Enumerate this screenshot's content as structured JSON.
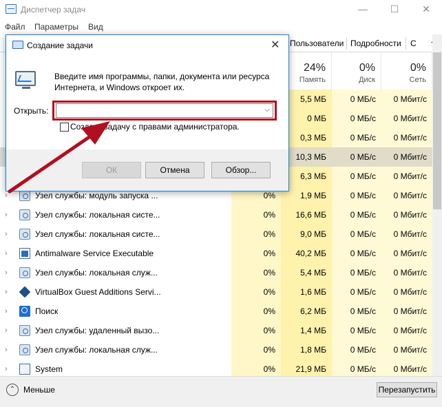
{
  "window": {
    "title": "Диспетчер задач",
    "min": "—",
    "max": "☐",
    "close": "✕"
  },
  "menu": [
    "Файл",
    "Параметры",
    "Вид"
  ],
  "tabs": [
    "Пользователи",
    "Подробности",
    "С"
  ],
  "tab_arrow": "◀▶",
  "columns": {
    "cpu": {
      "pct": "",
      "label": ""
    },
    "memory": {
      "pct": "24%",
      "label": "Память"
    },
    "disk": {
      "pct": "0%",
      "label": "Диск"
    },
    "network": {
      "pct": "0%",
      "label": "Сеть"
    }
  },
  "rows": [
    {
      "name": "",
      "icon": "",
      "cpu": "",
      "mem": "5,5 МБ",
      "disk": "0 МБ/с",
      "net": "0 Мбит/с"
    },
    {
      "name": "",
      "icon": "",
      "cpu": "",
      "mem": "0 МБ",
      "disk": "0 МБ/с",
      "net": "0 Мбит/с"
    },
    {
      "name": "",
      "icon": "",
      "cpu": "",
      "mem": "0,3 МБ",
      "disk": "0 МБ/с",
      "net": "0 Мбит/с"
    },
    {
      "name": "",
      "icon": "",
      "cpu": "",
      "mem": "10,3 МБ",
      "disk": "0 МБ/с",
      "net": "0 Мбит/с",
      "selected": true
    },
    {
      "name": "",
      "icon": "",
      "cpu": "",
      "mem": "6,3 МБ",
      "disk": "0 МБ/с",
      "net": "0 Мбит/с"
    },
    {
      "name": "Узел службы: модуль запуска ...",
      "icon": "gear-icon",
      "cpu": "0%",
      "mem": "1,9 МБ",
      "disk": "0 МБ/с",
      "net": "0 Мбит/с"
    },
    {
      "name": "Узел службы: локальная систе...",
      "icon": "gear-icon",
      "cpu": "0%",
      "mem": "16,6 МБ",
      "disk": "0 МБ/с",
      "net": "0 Мбит/с"
    },
    {
      "name": "Узел службы: локальная систе...",
      "icon": "gear-icon",
      "cpu": "0%",
      "mem": "9,0 МБ",
      "disk": "0 МБ/с",
      "net": "0 Мбит/с"
    },
    {
      "name": "Antimalware Service Executable",
      "icon": "window-icon",
      "cpu": "0%",
      "mem": "40,2 МБ",
      "disk": "0 МБ/с",
      "net": "0 Мбит/с"
    },
    {
      "name": "Узел службы: локальная служ...",
      "icon": "gear-icon",
      "cpu": "0%",
      "mem": "5,4 МБ",
      "disk": "0 МБ/с",
      "net": "0 Мбит/с"
    },
    {
      "name": "VirtualBox Guest Additions Servi...",
      "icon": "virtualbox-icon",
      "cpu": "0%",
      "mem": "1,6 МБ",
      "disk": "0 МБ/с",
      "net": "0 Мбит/с"
    },
    {
      "name": "Поиск",
      "icon": "search-app-icon",
      "cpu": "0%",
      "mem": "6,2 МБ",
      "disk": "0 МБ/с",
      "net": "0 Мбит/с"
    },
    {
      "name": "Узел службы: удаленный вызо...",
      "icon": "gear-icon",
      "cpu": "0%",
      "mem": "1,4 МБ",
      "disk": "0 МБ/с",
      "net": "0 Мбит/с"
    },
    {
      "name": "Узел службы: локальная служ...",
      "icon": "gear-icon",
      "cpu": "0%",
      "mem": "1,8 МБ",
      "disk": "0 МБ/с",
      "net": "0 Мбит/с"
    },
    {
      "name": "System",
      "icon": "system-icon",
      "cpu": "0%",
      "mem": "21,9 МБ",
      "disk": "0 МБ/с",
      "net": "0 Мбит/с"
    }
  ],
  "footer": {
    "less_label": "Меньше",
    "restart_label": "Перезапустить"
  },
  "dialog": {
    "title": "Создание задачи",
    "close": "✕",
    "description": "Введите имя программы, папки, документа или ресурса Интернета, и Windows откроет их.",
    "open_label": "Открыть:",
    "open_value": "",
    "checkbox_label": "Создать задачу с правами администратора.",
    "checkbox_checked": false,
    "ok_label": "ОК",
    "cancel_label": "Отмена",
    "browse_label": "Обзор..."
  },
  "annotation_color": "#b01020"
}
